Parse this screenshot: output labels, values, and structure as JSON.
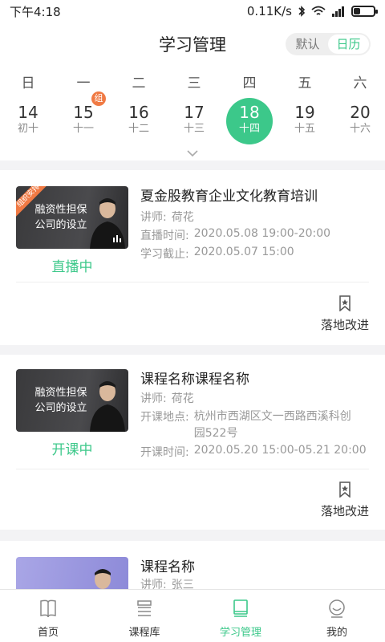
{
  "status_bar": {
    "time": "下午4:18",
    "net": "0.11K/s"
  },
  "header": {
    "title": "学习管理",
    "toggle_default": "默认",
    "toggle_calendar": "日历"
  },
  "calendar": {
    "weekdays": [
      "日",
      "一",
      "二",
      "三",
      "四",
      "五",
      "六"
    ],
    "days": [
      {
        "num": "14",
        "lunar": "初十"
      },
      {
        "num": "15",
        "lunar": "十一",
        "badge": "组"
      },
      {
        "num": "16",
        "lunar": "十二"
      },
      {
        "num": "17",
        "lunar": "十三"
      },
      {
        "num": "18",
        "lunar": "十四",
        "selected": true
      },
      {
        "num": "19",
        "lunar": "十五"
      },
      {
        "num": "20",
        "lunar": "十六"
      }
    ]
  },
  "courses": [
    {
      "title": "夏金股教育企业文化教育培训",
      "thumb_text": "融资性担保\n公司的设立",
      "thumb_ribbon": "组织安排",
      "status": "直播中",
      "rows": [
        {
          "label": "讲师:",
          "value": "荷花"
        },
        {
          "label": "直播时间:",
          "value": "2020.05.08 19:00-20:00"
        },
        {
          "label": "学习截止:",
          "value": "2020.05.07 15:00"
        }
      ],
      "action": "落地改进"
    },
    {
      "title": "课程名称课程名称",
      "thumb_text": "融资性担保\n公司的设立",
      "status": "开课中",
      "rows": [
        {
          "label": "讲师:",
          "value": "荷花"
        },
        {
          "label": "开课地点:",
          "value": "杭州市西湖区文一西路西溪科创园522号"
        },
        {
          "label": "开课时间:",
          "value": "2020.05.20 15:00-05.21 20:00"
        }
      ],
      "action": "落地改进"
    },
    {
      "title": "课程名称",
      "rows": [
        {
          "label": "讲师:",
          "value": "张三"
        }
      ]
    }
  ],
  "tabbar": [
    {
      "label": "首页",
      "icon": "book-icon"
    },
    {
      "label": "课程库",
      "icon": "stack-icon"
    },
    {
      "label": "学习管理",
      "icon": "notebook-icon",
      "active": true
    },
    {
      "label": "我的",
      "icon": "user-icon"
    }
  ],
  "colors": {
    "accent": "#3cc88a",
    "badge": "#f07a44",
    "separator": "#f3f3f5"
  }
}
